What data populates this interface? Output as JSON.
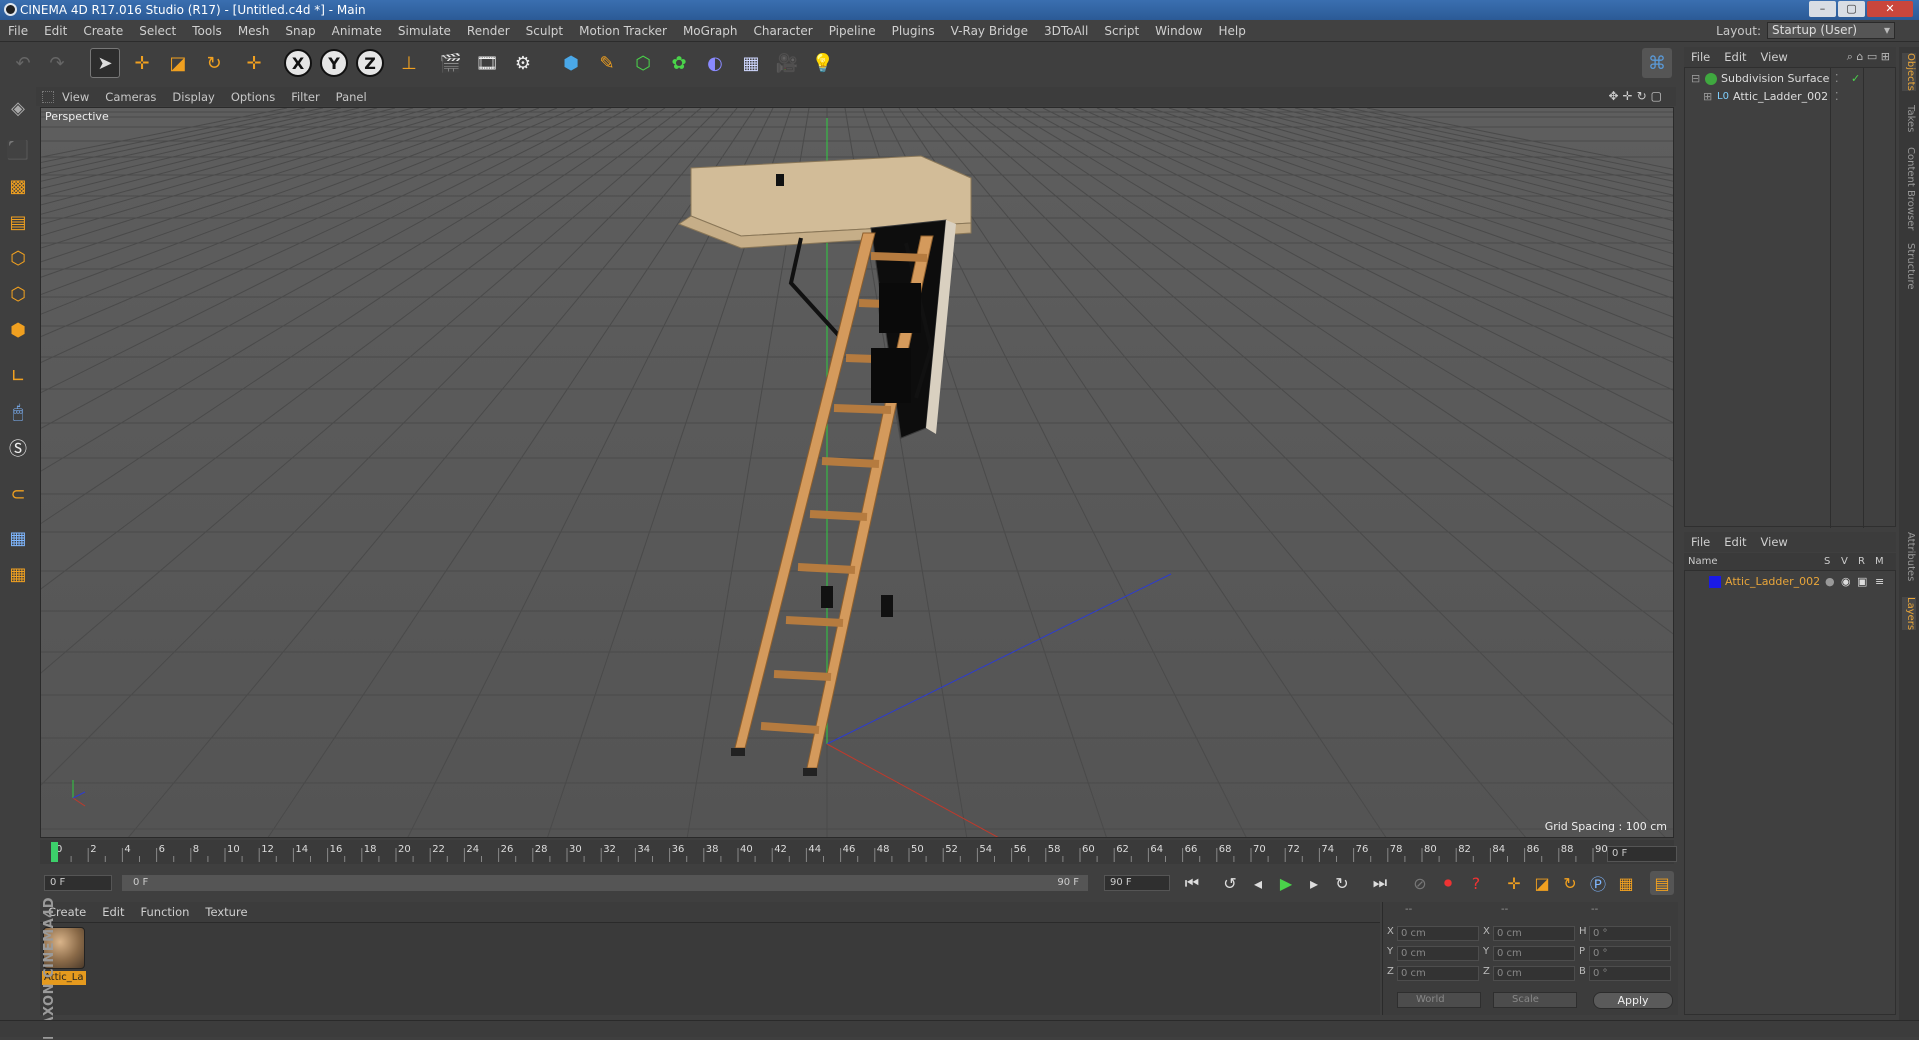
{
  "window": {
    "title": "CINEMA 4D R17.016 Studio (R17) - [Untitled.c4d *] - Main"
  },
  "menubar": {
    "items": [
      "File",
      "Edit",
      "Create",
      "Select",
      "Tools",
      "Mesh",
      "Snap",
      "Animate",
      "Simulate",
      "Render",
      "Sculpt",
      "Motion Tracker",
      "MoGraph",
      "Character",
      "Pipeline",
      "Plugins",
      "V-Ray Bridge",
      "3DToAll",
      "Script",
      "Window",
      "Help"
    ],
    "layout_label": "Layout:",
    "layout_value": "Startup (User)"
  },
  "toolbar": {
    "icons": [
      "undo-icon",
      "redo-icon",
      "select-arrow-icon",
      "move-icon",
      "scale-icon",
      "rotate-icon",
      "last-tool-icon",
      "x-axis-icon",
      "y-axis-icon",
      "z-axis-icon",
      "coordinate-system-icon",
      "render-view-icon",
      "render-picture-viewer-icon",
      "edit-render-settings-icon",
      "cube-icon",
      "pen-icon",
      "subdivision-icon",
      "array-icon",
      "deformer-icon",
      "floor-icon",
      "camera-icon",
      "light-icon",
      "python-icon"
    ],
    "axis_labels": [
      "X",
      "Y",
      "Z"
    ]
  },
  "viewport": {
    "menu": [
      "View",
      "Cameras",
      "Display",
      "Options",
      "Filter",
      "Panel"
    ],
    "label": "Perspective",
    "grid_spacing": "Grid Spacing : 100 cm"
  },
  "timeline": {
    "ticks": [
      "0",
      "2",
      "4",
      "6",
      "8",
      "10",
      "12",
      "14",
      "16",
      "18",
      "20",
      "22",
      "24",
      "26",
      "28",
      "30",
      "32",
      "34",
      "36",
      "38",
      "40",
      "42",
      "44",
      "46",
      "48",
      "50",
      "52",
      "54",
      "56",
      "58",
      "60",
      "62",
      "64",
      "66",
      "68",
      "70",
      "72",
      "74",
      "76",
      "78",
      "80",
      "82",
      "84",
      "86",
      "88",
      "90"
    ],
    "current_frame": "0 F"
  },
  "transport": {
    "start_field": "0 F",
    "range_start": "0 F",
    "range_end": "90 F",
    "end_field": "90 F"
  },
  "material_manager": {
    "menu": [
      "Create",
      "Edit",
      "Function",
      "Texture"
    ],
    "material_name": "Attic_La"
  },
  "brand": "MAXON CINEMA4D",
  "coordinates": {
    "headers": [
      "--",
      "--",
      "--"
    ],
    "rows": [
      {
        "a": "X",
        "av": "0 cm",
        "b": "X",
        "bv": "0 cm",
        "c": "H",
        "cv": "0 °"
      },
      {
        "a": "Y",
        "av": "0 cm",
        "b": "Y",
        "bv": "0 cm",
        "c": "P",
        "cv": "0 °"
      },
      {
        "a": "Z",
        "av": "0 cm",
        "b": "Z",
        "bv": "0 cm",
        "c": "B",
        "cv": "0 °"
      }
    ],
    "world": "World",
    "scale": "Scale",
    "apply": "Apply"
  },
  "object_manager": {
    "menu": [
      "File",
      "Edit",
      "View"
    ],
    "objects": [
      {
        "name": "Subdivision Surface"
      },
      {
        "name": "Attic_Ladder_002"
      }
    ]
  },
  "layer_manager": {
    "menu": [
      "File",
      "Edit",
      "View"
    ],
    "col_name": "Name",
    "flag_cols": [
      "S",
      "V",
      "R",
      "M"
    ],
    "layers": [
      {
        "name": "Attic_Ladder_002",
        "color": "#1a1ae6"
      }
    ]
  },
  "side_tabs": [
    "Objects",
    "Takes",
    "Content Browser",
    "Structure",
    "Attributes",
    "Layers"
  ],
  "colors": {
    "accent": "#e8a53a",
    "viewport_bg": "#5a5a5a",
    "x_axis": "#c0392b",
    "y_axis": "#2ecc40",
    "z_axis": "#2d3ccf"
  }
}
